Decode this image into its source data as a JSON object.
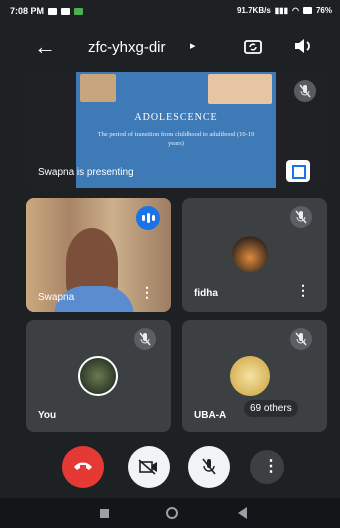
{
  "status_bar": {
    "time": "7:08 PM",
    "network_speed": "91.7KB/s",
    "battery": "76%"
  },
  "header": {
    "meeting_code": "zfc-yhxg-dir",
    "caret": "▸",
    "back_icon": "arrow-back-icon",
    "camera_switch_icon": "camera-switch-icon",
    "speaker_icon": "speaker-icon"
  },
  "presentation": {
    "slide_title": "ADOLESCENCE",
    "slide_text": "The period of transition from childhood to adulthood (10-19 years)",
    "caption": "Swapna is presenting"
  },
  "participants": [
    {
      "name": "Swapna",
      "speaking": true
    },
    {
      "name": "fidha",
      "muted": true
    },
    {
      "name": "You",
      "muted": true
    },
    {
      "name": "UBA-A",
      "muted": true
    }
  ],
  "others_count_label": "69 others",
  "more_glyph": "⋮",
  "controls": {
    "end_call_icon": "phone-hangup-icon",
    "camera_icon": "camera-off-icon",
    "mic_icon": "mic-off-icon",
    "more_icon": "more-vert-icon"
  },
  "colors": {
    "background": "#1e2124",
    "tile": "#3c4043",
    "end_call": "#e53935",
    "accent": "#1a73e8"
  }
}
